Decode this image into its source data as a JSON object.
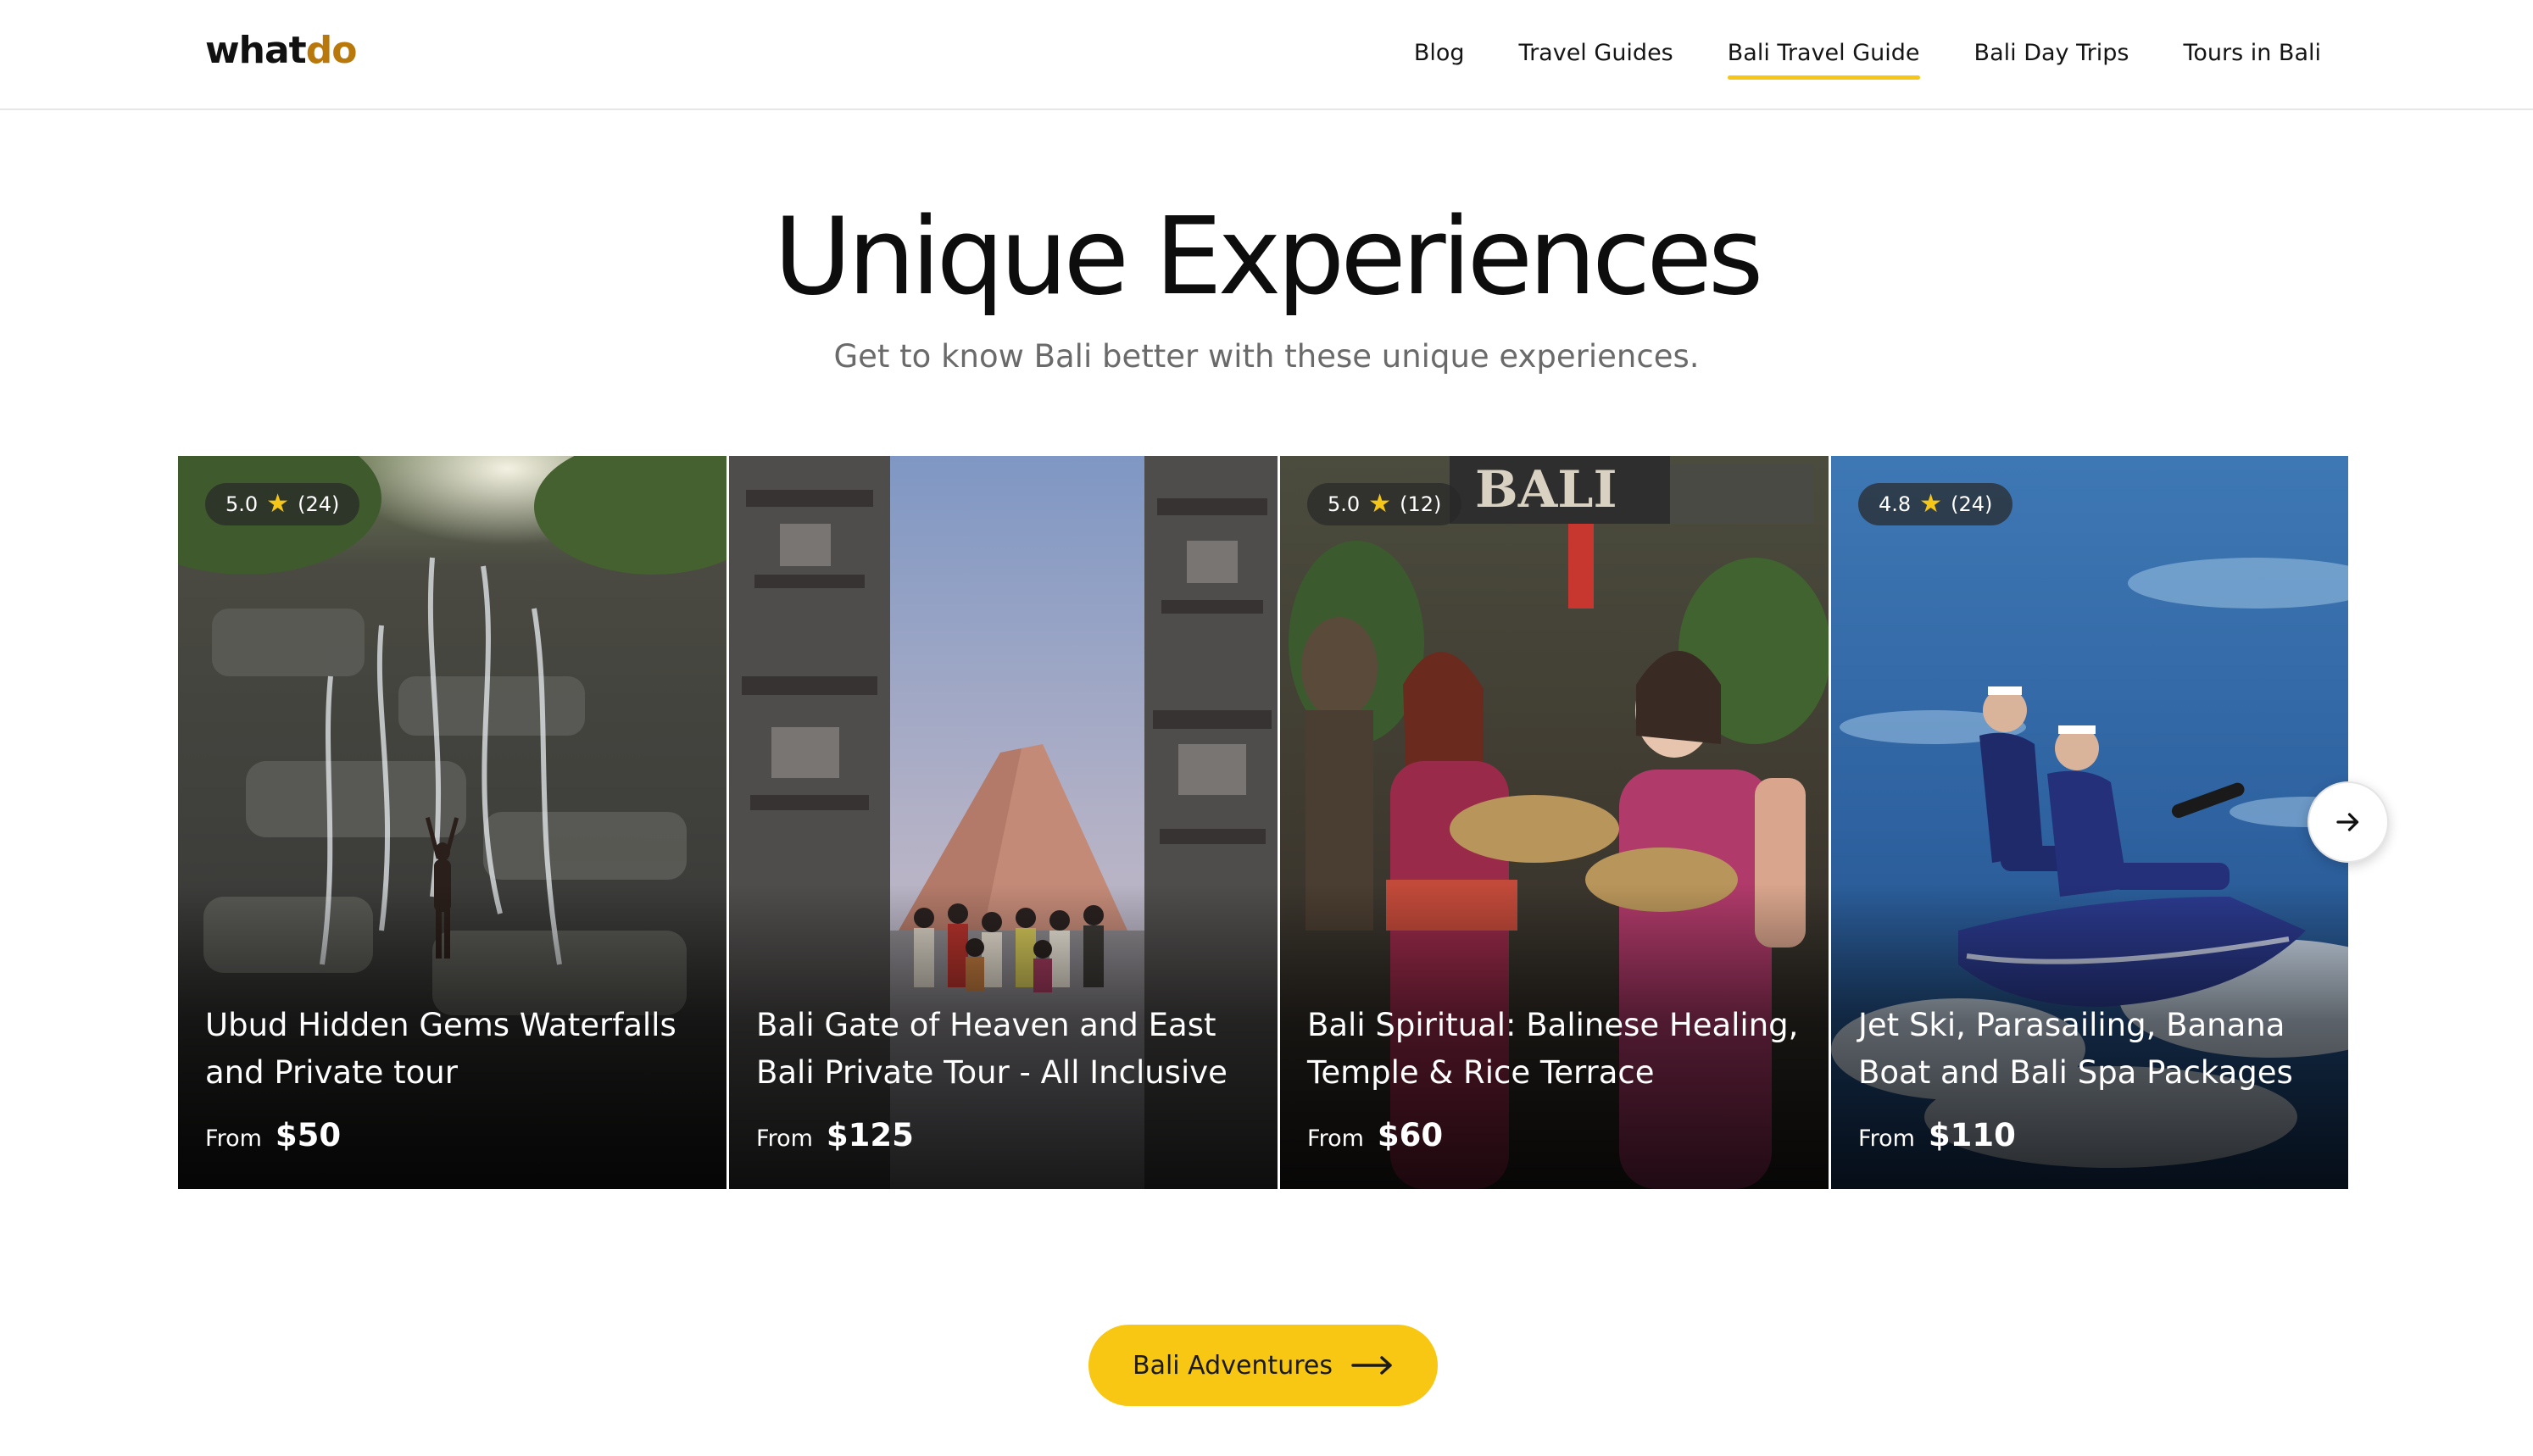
{
  "header": {
    "logo_part1": "what",
    "logo_part2": "do",
    "nav": [
      {
        "label": "Blog",
        "active": false
      },
      {
        "label": "Travel Guides",
        "active": false
      },
      {
        "label": "Bali Travel Guide",
        "active": true
      },
      {
        "label": "Bali Day Trips",
        "active": false
      },
      {
        "label": "Tours in Bali",
        "active": false
      }
    ]
  },
  "main": {
    "title": "Unique Experiences",
    "subtitle": "Get to know Bali better with these unique experiences.",
    "cards": [
      {
        "rating": "5.0",
        "reviews": "(24)",
        "title": "Ubud Hidden Gems Waterfalls and Private tour",
        "from_label": "From",
        "price": "$50",
        "image": "waterfall-photo"
      },
      {
        "rating": "",
        "reviews": "",
        "title": "Bali Gate of Heaven and East Bali Private Tour - All Inclusive",
        "from_label": "From",
        "price": "$125",
        "image": "temple-gate-photo"
      },
      {
        "rating": "5.0",
        "reviews": "(12)",
        "title": "Bali Spiritual: Balinese Healing, Temple & Rice Terrace",
        "from_label": "From",
        "price": "$60",
        "image": "temple-offerings-photo"
      },
      {
        "rating": "4.8",
        "reviews": "(24)",
        "title": "Jet Ski, Parasailing, Banana Boat and Bali Spa Packages",
        "from_label": "From",
        "price": "$110",
        "image": "jet-ski-photo"
      }
    ],
    "next_icon": "arrow-right-icon",
    "cta_label": "Bali Adventures",
    "cta_icon": "long-arrow-right-icon"
  },
  "colors": {
    "accent": "#f7c713",
    "logo_accent": "#b8780b",
    "star": "#f5c518"
  }
}
